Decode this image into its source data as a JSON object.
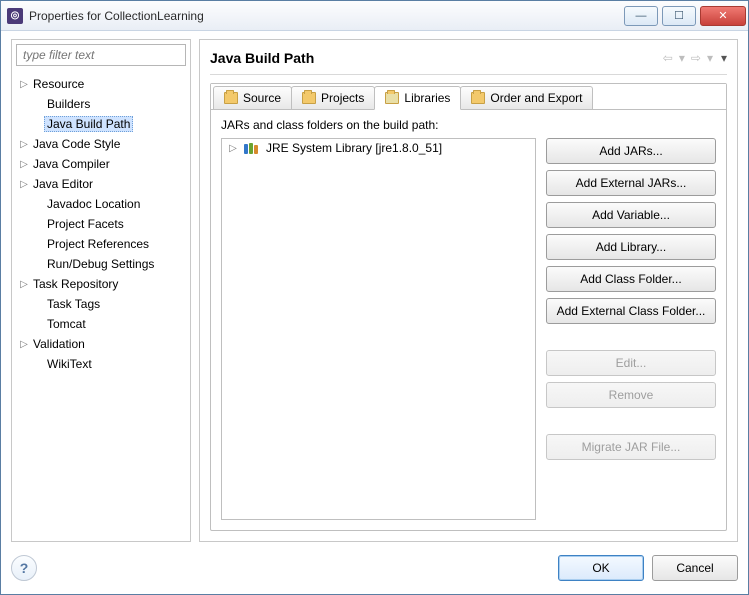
{
  "window": {
    "title": "Properties for CollectionLearning"
  },
  "filter": {
    "placeholder": "type filter text"
  },
  "tree": {
    "items": [
      {
        "label": "Resource",
        "expandable": true
      },
      {
        "label": "Builders",
        "expandable": false,
        "indent": true
      },
      {
        "label": "Java Build Path",
        "expandable": false,
        "indent": true,
        "selected": true
      },
      {
        "label": "Java Code Style",
        "expandable": true
      },
      {
        "label": "Java Compiler",
        "expandable": true
      },
      {
        "label": "Java Editor",
        "expandable": true
      },
      {
        "label": "Javadoc Location",
        "expandable": false,
        "indent": true
      },
      {
        "label": "Project Facets",
        "expandable": false,
        "indent": true
      },
      {
        "label": "Project References",
        "expandable": false,
        "indent": true
      },
      {
        "label": "Run/Debug Settings",
        "expandable": false,
        "indent": true
      },
      {
        "label": "Task Repository",
        "expandable": true
      },
      {
        "label": "Task Tags",
        "expandable": false,
        "indent": true
      },
      {
        "label": "Tomcat",
        "expandable": false,
        "indent": true
      },
      {
        "label": "Validation",
        "expandable": true
      },
      {
        "label": "WikiText",
        "expandable": false,
        "indent": true
      }
    ]
  },
  "page": {
    "title": "Java Build Path"
  },
  "tabs": {
    "items": [
      {
        "label": "Source",
        "active": false
      },
      {
        "label": "Projects",
        "active": false
      },
      {
        "label": "Libraries",
        "active": true
      },
      {
        "label": "Order and Export",
        "active": false
      }
    ]
  },
  "libraries": {
    "caption": "JARs and class folders on the build path:",
    "entries": [
      {
        "label": "JRE System Library [jre1.8.0_51]"
      }
    ]
  },
  "buttons": {
    "add_jars": "Add JARs...",
    "add_ext_jars": "Add External JARs...",
    "add_variable": "Add Variable...",
    "add_library": "Add Library...",
    "add_class_folder": "Add Class Folder...",
    "add_ext_class_folder": "Add External Class Folder...",
    "edit": "Edit...",
    "remove": "Remove",
    "migrate": "Migrate JAR File..."
  },
  "footer": {
    "ok": "OK",
    "cancel": "Cancel"
  }
}
